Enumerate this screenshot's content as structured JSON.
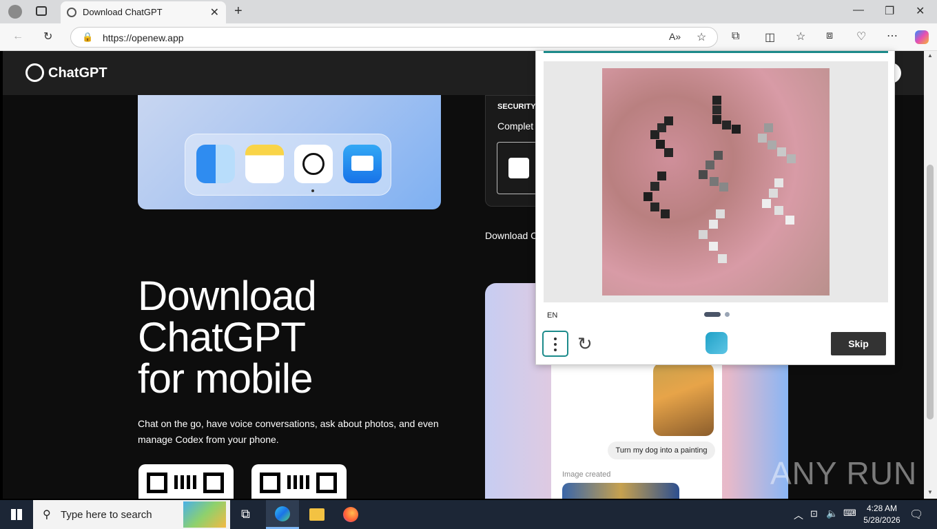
{
  "browser": {
    "tab_title": "Download ChatGPT",
    "url": "https://openew.app"
  },
  "site": {
    "logo_text": "ChatGPT",
    "security_label": "SECURITY",
    "security_text": "Complet",
    "download_link": "Download C",
    "heading_lines": [
      "Download",
      "ChatGPT",
      "for mobile"
    ],
    "description": "Chat on the go, have voice conversations, ask about photos, and even manage Codex from your phone.",
    "chat_bubble": "Turn my dog into a painting",
    "image_created": "Image created"
  },
  "captcha": {
    "language": "EN",
    "skip_label": "Skip"
  },
  "taskbar": {
    "search_placeholder": "Type here to search",
    "time": "4:28 AM",
    "date": "5/28/2026"
  },
  "watermark": "ANY RUN"
}
